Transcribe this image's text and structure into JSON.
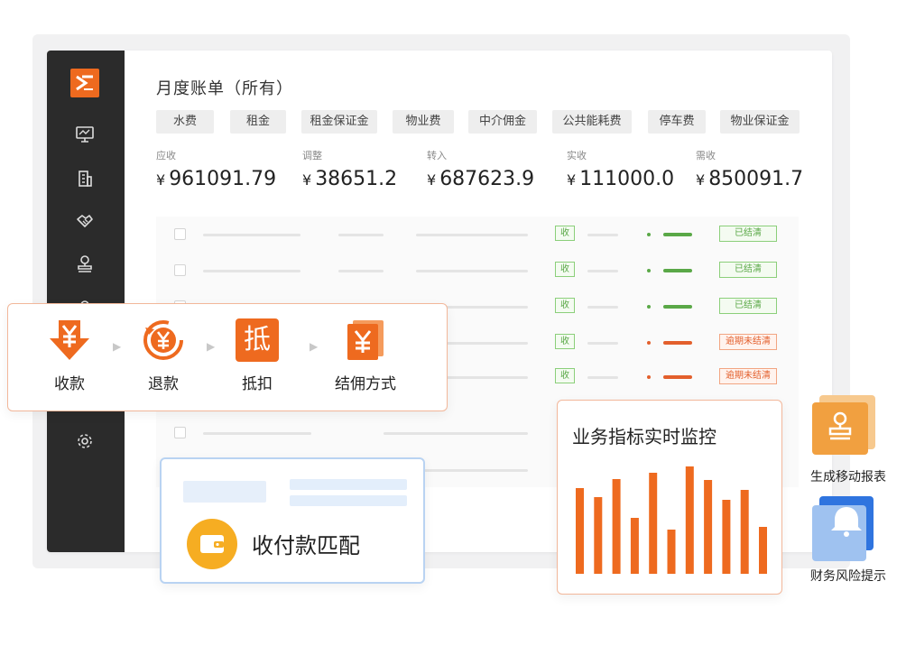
{
  "bill": {
    "title": "月度账单（所有）",
    "tabs": [
      "水费",
      "租金",
      "租金保证金",
      "物业费",
      "中介佣金",
      "公共能耗费",
      "停车费",
      "物业保证金"
    ],
    "stats": [
      {
        "label": "应收",
        "currency": "¥",
        "value": "961091.79"
      },
      {
        "label": "调整",
        "currency": "¥",
        "value": "38651.2"
      },
      {
        "label": "转入",
        "currency": "¥",
        "value": "687623.9"
      },
      {
        "label": "实收",
        "currency": "¥",
        "value": "111000.0"
      },
      {
        "label": "需收",
        "currency": "¥",
        "value": "850091.7"
      }
    ],
    "rows": [
      {
        "tag": "收",
        "status": "已结清",
        "state": "ok"
      },
      {
        "tag": "收",
        "status": "已结清",
        "state": "ok"
      },
      {
        "tag": "收",
        "status": "已结清",
        "state": "ok"
      },
      {
        "tag": "收",
        "status": "逾期未结清",
        "state": "late"
      },
      {
        "tag": "收",
        "status": "逾期未结清",
        "state": "late"
      }
    ]
  },
  "payment_methods": [
    {
      "label": "收款",
      "icon": "yen-down-arrow-icon"
    },
    {
      "label": "退款",
      "icon": "yen-refund-icon"
    },
    {
      "label": "抵扣",
      "icon": "deduct-char-icon",
      "glyph": "抵"
    },
    {
      "label": "结佣方式",
      "icon": "yen-stack-icon"
    }
  ],
  "match": {
    "label": "收付款匹配",
    "icon": "wallet-icon"
  },
  "monitor": {
    "title": "业务指标实时监控",
    "chart_data": {
      "type": "bar",
      "values": [
        95,
        85,
        105,
        62,
        112,
        49,
        119,
        104,
        82,
        93,
        52
      ],
      "ylim": [
        0,
        125
      ],
      "xlabel": "",
      "ylabel": ""
    }
  },
  "features": [
    {
      "label": "生成移动报表",
      "icon": "stamp-report-icon"
    },
    {
      "label": "财务风险提示",
      "icon": "bell-icon"
    }
  ],
  "colors": {
    "accent": "#ee6a1f",
    "sidebar": "#2b2b2b",
    "ok": "#5aa847",
    "late": "#e35f2c",
    "blue": "#3d7fe0"
  }
}
